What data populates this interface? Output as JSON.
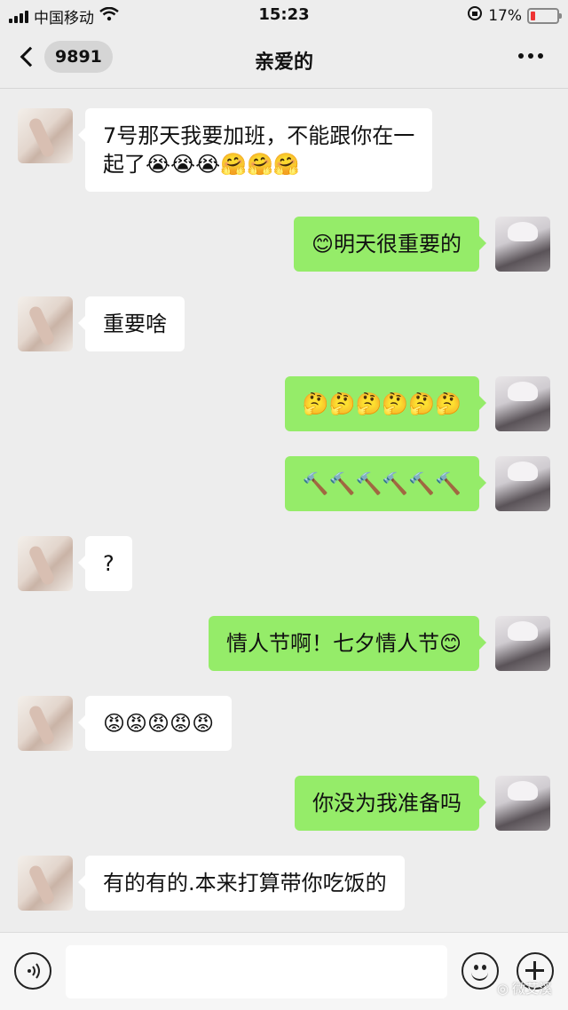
{
  "status_bar": {
    "carrier": "中国移动",
    "time": "15:23",
    "battery": "17%",
    "battery_level": 0.17
  },
  "header": {
    "back_count": "9891",
    "title": "亲爱的"
  },
  "messages": [
    {
      "side": "left",
      "text": "7号那天我要加班，不能跟你在一\n起了😭😭😭🤗🤗🤗"
    },
    {
      "side": "right",
      "text": "😊明天很重要的"
    },
    {
      "side": "left",
      "text": "重要啥"
    },
    {
      "side": "right",
      "text": "🤔🤔🤔🤔🤔🤔"
    },
    {
      "side": "right",
      "text": "🔨🔨🔨🔨🔨🔨"
    },
    {
      "side": "left",
      "text": "?"
    },
    {
      "side": "right",
      "text": "情人节啊！七夕情人节😊"
    },
    {
      "side": "left",
      "text": "😡😡😡😡😡"
    },
    {
      "side": "right",
      "text": "你没为我准备吗"
    },
    {
      "side": "left",
      "text": "有的有的.本来打算带你吃饭的"
    }
  ],
  "watermark": "微艾溪",
  "colors": {
    "sent_bubble": "#95ec69",
    "received_bubble": "#ffffff",
    "background": "#ededed"
  }
}
